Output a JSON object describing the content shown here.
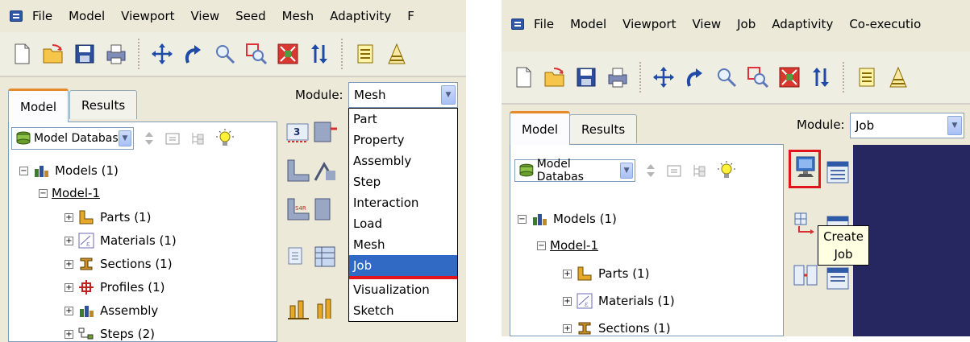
{
  "left": {
    "menu": [
      "File",
      "Model",
      "Viewport",
      "View",
      "Seed",
      "Mesh",
      "Adaptivity",
      "F"
    ],
    "tabs": [
      "Model",
      "Results"
    ],
    "db_combo": "Model Databas",
    "tree": {
      "models": "Models (1)",
      "model1": "Model-1",
      "items": [
        "Parts (1)",
        "Materials (1)",
        "Sections (1)",
        "Profiles (1)",
        "Assembly",
        "Steps (2)"
      ]
    },
    "module_label": "Module:",
    "module_value": "Mesh",
    "dropdown": [
      "Part",
      "Property",
      "Assembly",
      "Step",
      "Interaction",
      "Load",
      "Mesh",
      "Job",
      "Visualization",
      "Sketch"
    ],
    "dropdown_selected": "Job"
  },
  "right": {
    "menu": [
      "File",
      "Model",
      "Viewport",
      "View",
      "Job",
      "Adaptivity",
      "Co-executio"
    ],
    "tabs": [
      "Model",
      "Results"
    ],
    "db_combo": "Model Databas",
    "tree": {
      "models": "Models (1)",
      "model1": "Model-1",
      "items": [
        "Parts (1)",
        "Materials (1)",
        "Sections (1)"
      ]
    },
    "module_label": "Module:",
    "module_value": "Job",
    "tooltip_line1": "Create",
    "tooltip_line2": "Job"
  },
  "colors": {
    "chrome": "#ece9d8",
    "selection": "#316ac5",
    "highlight_red": "#e1141e",
    "active_tab_accent": "#e68b2c",
    "viewport": "#262660"
  },
  "icons": [
    "app-menu-icon",
    "new-file-icon",
    "open-file-icon",
    "save-icon",
    "print-icon",
    "pan-icon",
    "rotate-icon",
    "zoom-icon",
    "box-zoom-icon",
    "auto-fit-icon",
    "cycle-views-icon",
    "stack-icon",
    "model-database-icon",
    "models-icon",
    "parts-icon",
    "materials-icon",
    "sections-icon",
    "profiles-icon",
    "assembly-icon",
    "steps-icon",
    "create-job-icon",
    "job-manager-icon"
  ]
}
